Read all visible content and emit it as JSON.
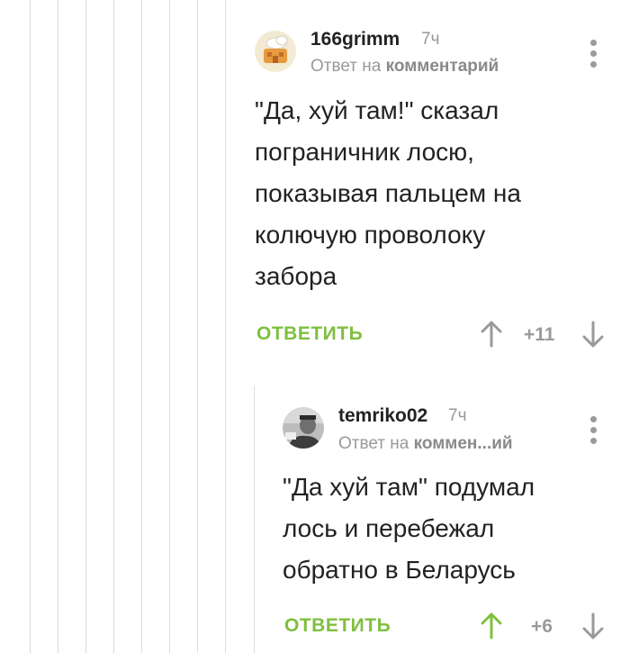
{
  "comments": [
    {
      "username": "166grimm",
      "time": "7ч",
      "reply_prefix": "Ответ на",
      "reply_target": "комментарий",
      "text": "\"Да, хуй там!\" сказал\nпограничник лосю,\nпоказывая пальцем на\nколючую проволоку\nзабора",
      "reply_label": "ОТВЕТИТЬ",
      "rating": "+11",
      "upvote_color": "#9a9a9a",
      "downvote_color": "#9a9a9a"
    },
    {
      "username": "temriko02",
      "time": "7ч",
      "reply_prefix": "Ответ на",
      "reply_target": "коммен...ий",
      "text": "\"Да хуй там\" подумал\nлось и перебежал\nобратно в Беларусь",
      "reply_label": "ОТВЕТИТЬ",
      "rating": "+6",
      "upvote_color": "#7fbf3f",
      "downvote_color": "#9a9a9a"
    }
  ],
  "icons": {
    "upvote": "arrow-up-icon",
    "downvote": "arrow-down-icon",
    "menu": "more-vertical-icon"
  },
  "colors": {
    "accent": "#7fbf3f",
    "muted": "#9a9a9a",
    "thread_line": "#dcdcdc"
  }
}
